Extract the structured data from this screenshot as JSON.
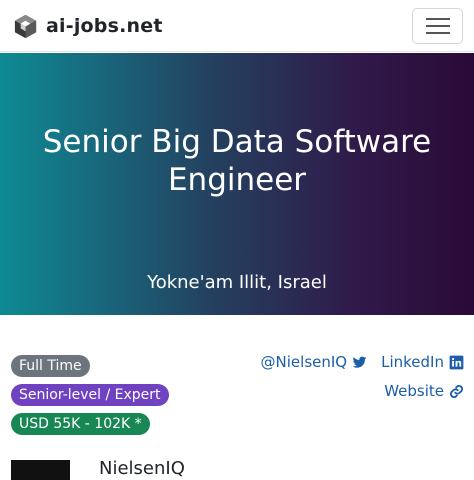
{
  "navbar": {
    "brand": "ai-jobs.net",
    "brand_icon": "cube-logo-icon",
    "menu_icon": "hamburger-menu-icon"
  },
  "hero": {
    "title": "Senior Big Data Software Engineer",
    "location": "Yokne'am Illit, Israel"
  },
  "badges": {
    "type": "Full Time",
    "level": "Senior-level / Expert",
    "salary": "USD 55K - 102K *"
  },
  "links": {
    "twitter": "@NielsenIQ",
    "linkedin": "LinkedIn",
    "website": "Website"
  },
  "company": {
    "name": "NielsenIQ"
  },
  "colors": {
    "link": "#1c5ea8",
    "badge_type": "#6c757d",
    "badge_level": "#6f42c1",
    "badge_salary": "#198754"
  }
}
